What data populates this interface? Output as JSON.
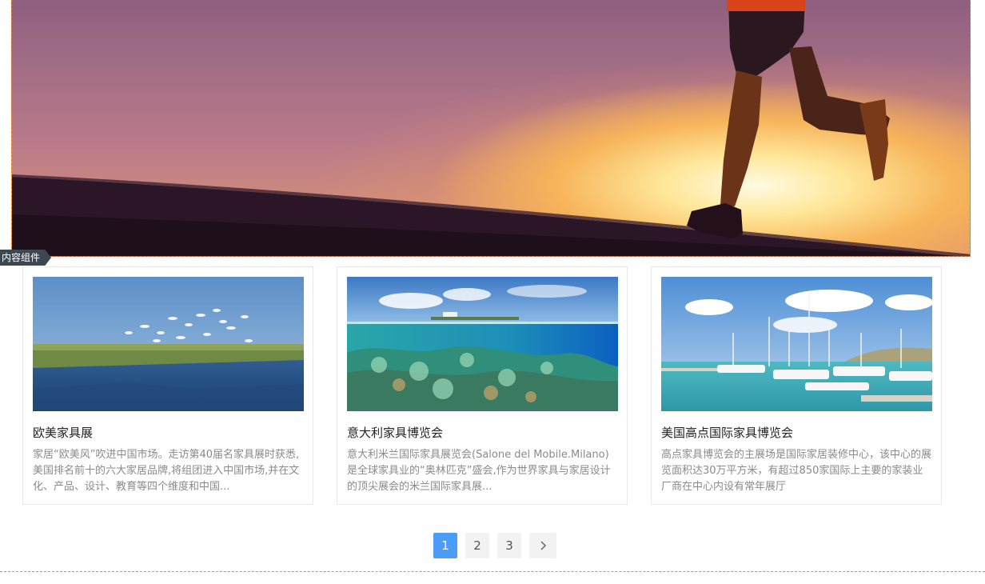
{
  "banner": {
    "badge": "内容组件"
  },
  "cards": [
    {
      "title": "欧美家具展",
      "desc": "家居“欧美风”吹进中国市场。走访第40届名家具展时获悉,美国排名前十的六大家居品牌,将组团进入中国市场,并在文化、产品、设计、教育等四个维度和中国...",
      "image": "wetland-birds"
    },
    {
      "title": "意大利家具博览会",
      "desc": "意大利米兰国际家具展览会(Salone del Mobile.Milano)是全球家具业的“奥林匹克”盛会,作为世界家具与家居设计的顶尖展会的米兰国际家具展...",
      "image": "coral-reef"
    },
    {
      "title": "美国高点国际家具博览会",
      "desc": "高点家具博览会的主展场是国际家居装修中心，该中心的展览面积达30万平方米，有超过850家国际上主要的家装业厂商在中心内设有常年展厅",
      "image": "marina-yachts"
    }
  ],
  "pagination": {
    "pages": [
      "1",
      "2",
      "3"
    ],
    "current": "1",
    "next_icon": "chevron-right-icon"
  },
  "colors": {
    "accent": "#4b9cf6",
    "desc_text": "#8a8a8a",
    "badge_bg": "#3d4752"
  }
}
